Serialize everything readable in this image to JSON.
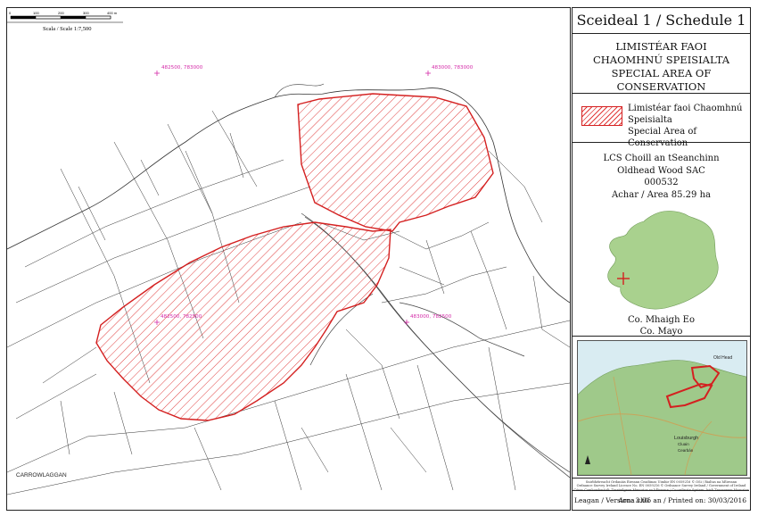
{
  "panel": {
    "title": "Sceideal 1 / Schedule 1",
    "subtitle_irish_1": "LIMISTÉAR FAOI",
    "subtitle_irish_2": "CHAOMHNÚ SPEISIALTA",
    "subtitle_english": "SPECIAL AREA OF CONSERVATION",
    "legend_irish": "Limistéar faoi Chaomhnú Speisialta",
    "legend_english": "Special Area of Conservation",
    "site_name_irish": "LCS Choill an tSeanchinn",
    "site_name_english": "Oldhead Wood SAC",
    "site_code": "000532",
    "area": "Achar / Area 85.29 ha",
    "county_irish": "Co. Mhaigh Eo",
    "county_english": "Co. Mayo",
    "credit": [
      "Suirbhéireacht Ordanáis Éireann Ceadúnas Uimhir EN 0059216 © OSi / Rialtas na hÉireann",
      "Ordnance Survey Ireland Licence No. EN 0059216 © Ordnance Survey Ireland / Government of Ireland",
      "Córas Comhordanáidí: Trasteilgean Mercator na hÉireann / Co-ordinate System: Irish Transverse Mercator"
    ],
    "version": "Leagan / Version: 3.01",
    "printed": "Arna chló an / Printed on: 30/03/2016"
  },
  "map": {
    "coords": [
      "482500, 783000",
      "483000, 783000",
      "482500, 782500",
      "483000, 782500"
    ],
    "placename": "CARROWLAGGAN",
    "scale_label": "Scala / Scale 1:7,500",
    "scale_ticks": [
      "0",
      "100",
      "200",
      "300",
      "400 m"
    ],
    "inset_labels": [
      "Old Head",
      "Louisburgh",
      "Cluain",
      "Cearbán"
    ]
  },
  "colors": {
    "sac_red": "#d42020",
    "coord_magenta": "#d42aa8",
    "sea_blue": "#d9ecf2",
    "inset_green": "#9fc98a"
  }
}
